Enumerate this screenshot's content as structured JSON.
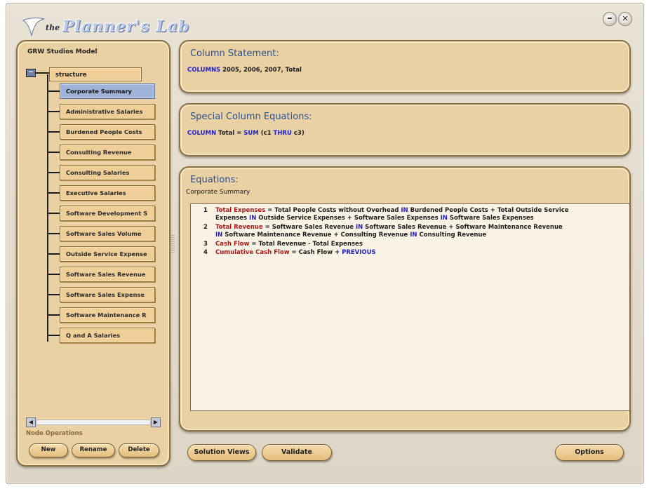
{
  "app": {
    "title_prefix": "the",
    "title": "Planner's Lab",
    "minimize_glyph": "–",
    "close_glyph": "✕"
  },
  "sidebar": {
    "model_title": "GRW Studios Model",
    "collapse_glyph": "−",
    "root_node": "structure",
    "selected_index": 0,
    "items": [
      {
        "label": "Corporate Summary"
      },
      {
        "label": "Administrative Salaries"
      },
      {
        "label": "Burdened People Costs"
      },
      {
        "label": "Consulting Revenue"
      },
      {
        "label": "Consulting Salaries"
      },
      {
        "label": "Executive Salaries"
      },
      {
        "label": "Software Development S"
      },
      {
        "label": "Software Sales Volume"
      },
      {
        "label": "Outside Service Expense"
      },
      {
        "label": "Software Sales Revenue"
      },
      {
        "label": "Software Sales Expense"
      },
      {
        "label": "Software Maintenance R"
      },
      {
        "label": "Q and A Salaries"
      }
    ],
    "scroll_left": "◀",
    "scroll_right": "▶",
    "node_operations_label": "Node Operations",
    "buttons": {
      "new": "New",
      "rename": "Rename",
      "delete": "Delete"
    }
  },
  "column_statement": {
    "title": "Column Statement:",
    "keyword": "COLUMNS",
    "rest": " 2005, 2006, 2007, Total"
  },
  "special_column_equations": {
    "title": "Special Column Equations:",
    "kw_column": "COLUMN",
    "text_1": " Total = ",
    "kw_sum": "SUM",
    "text_2": " (c1 ",
    "kw_thru": "THRU",
    "text_3": " c3)"
  },
  "equations": {
    "title": "Equations:",
    "subtitle": "Corporate Summary",
    "eq1": {
      "num": "1",
      "name": "Total Expenses",
      "l1a": " = Total People Costs without Overhead ",
      "kw1": "IN",
      "l1b": " Burdened People Costs + Total Outside Service",
      "l2a": "Expenses ",
      "kw2": "IN",
      "l2b": " Outside Service Expenses + Software Sales Expenses ",
      "kw3": "IN",
      "l2c": " Software Sales Expenses"
    },
    "eq2": {
      "num": "2",
      "name": "Total Revenue",
      "l1a": " = Software Sales Revenue ",
      "kw1": "IN",
      "l1b": " Software Sales Revenue + Software Maintenance Revenue",
      "kw2": "IN",
      "l2a": " Software Maintenance Revenue + Consulting Revenue ",
      "kw3": "IN",
      "l2b": " Consulting Revenue"
    },
    "eq3": {
      "num": "3",
      "name": "Cash Flow",
      "rest": " = Total Revenue - Total Expenses"
    },
    "eq4": {
      "num": "4",
      "name": "Cumulative Cash Flow",
      "rest": " = Cash Flow + ",
      "kw": "PREVIOUS"
    }
  },
  "footer": {
    "solution_views": "Solution Views",
    "validate": "Validate",
    "options": "Options"
  },
  "colors": {
    "panel": "#e9d1a4",
    "panel_border": "#8c6f3f",
    "selected_node": "#9fb2d8",
    "title_blue": "#2d4f8f",
    "keyword_blue": "#2020c8",
    "keyword_red": "#b01818"
  }
}
